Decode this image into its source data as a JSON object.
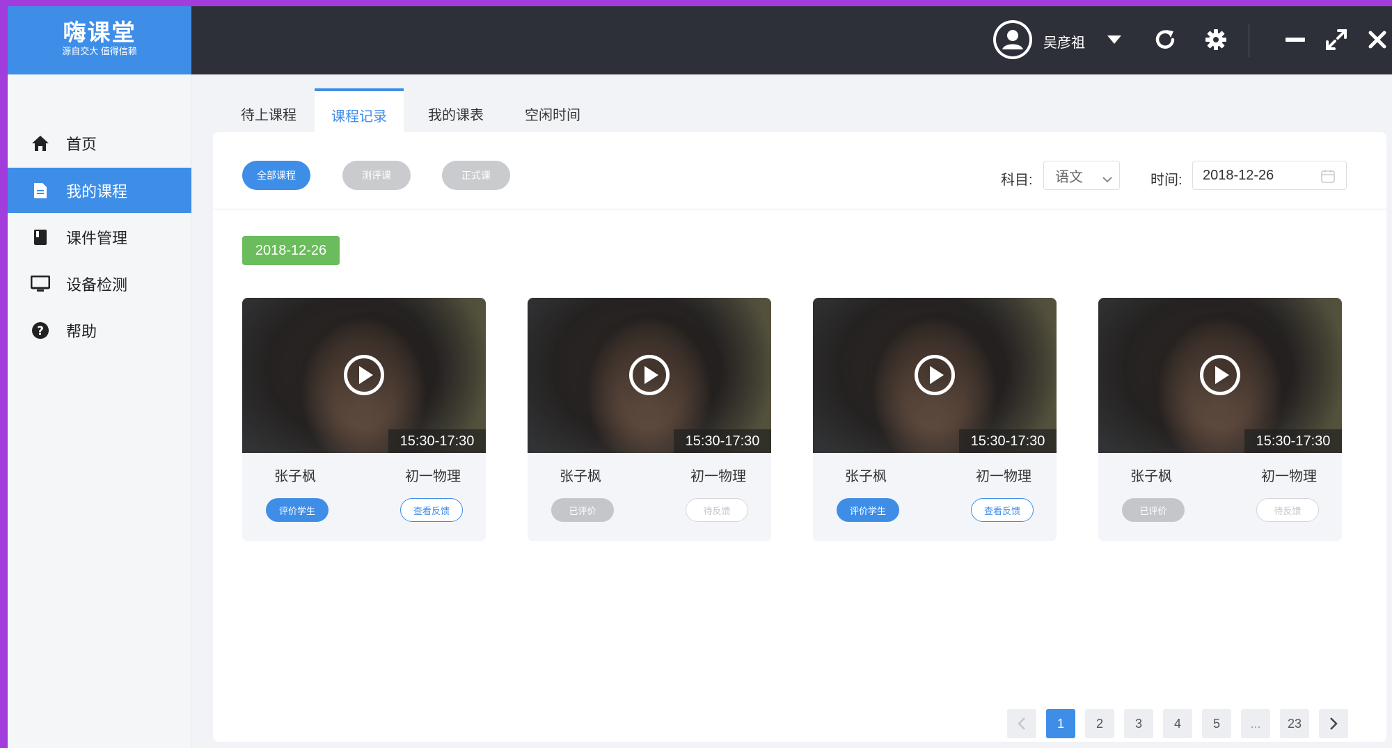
{
  "app": {
    "logo_title": "嗨课堂",
    "logo_subtitle": "源自交大 值得信赖"
  },
  "header": {
    "username": "吴彦祖"
  },
  "sidebar": {
    "items": [
      {
        "label": "首页",
        "icon": "home-icon"
      },
      {
        "label": "我的课程",
        "icon": "document-icon",
        "active": true
      },
      {
        "label": "课件管理",
        "icon": "book-icon"
      },
      {
        "label": "设备检测",
        "icon": "monitor-icon"
      },
      {
        "label": "帮助",
        "icon": "help-icon"
      }
    ]
  },
  "tabs": [
    {
      "label": "待上课程"
    },
    {
      "label": "课程记录",
      "active": true
    },
    {
      "label": "我的课表"
    },
    {
      "label": "空闲时间"
    }
  ],
  "filters": {
    "pills": [
      {
        "label": "全部课程",
        "active": true
      },
      {
        "label": "测评课"
      },
      {
        "label": "正式课"
      }
    ],
    "subject_label": "科目:",
    "subject_value": "语文",
    "time_label": "时间:",
    "time_value": "2018-12-26"
  },
  "date_group": "2018-12-26",
  "cards": [
    {
      "time": "15:30-17:30",
      "teacher": "张子枫",
      "course": "初一物理",
      "btn_left": "评价学生",
      "btn_right": "查看反馈",
      "state": "active"
    },
    {
      "time": "15:30-17:30",
      "teacher": "张子枫",
      "course": "初一物理",
      "btn_left": "已评价",
      "btn_right": "待反馈",
      "state": "done"
    },
    {
      "time": "15:30-17:30",
      "teacher": "张子枫",
      "course": "初一物理",
      "btn_left": "评价学生",
      "btn_right": "查看反馈",
      "state": "active"
    },
    {
      "time": "15:30-17:30",
      "teacher": "张子枫",
      "course": "初一物理",
      "btn_left": "已评价",
      "btn_right": "待反馈",
      "state": "done"
    }
  ],
  "pagination": {
    "pages": [
      "1",
      "2",
      "3",
      "4",
      "5",
      "...",
      "23"
    ],
    "current": "1"
  },
  "colors": {
    "accent": "#3e8ee8",
    "header_bg": "#2e3039",
    "date_badge": "#6bbc5c",
    "frame": "#a23cdc"
  }
}
